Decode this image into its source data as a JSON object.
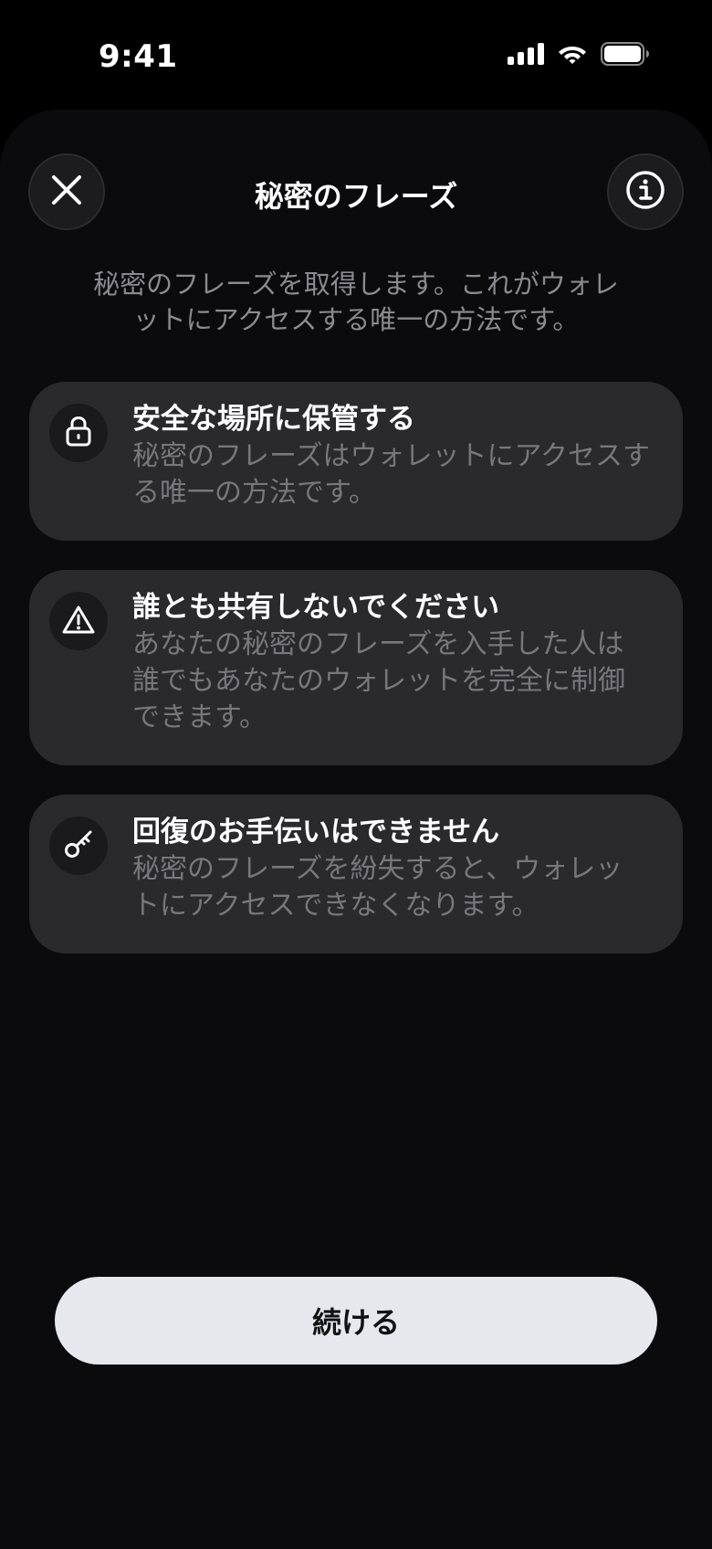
{
  "status_bar": {
    "time": "9:41"
  },
  "header": {
    "title": "秘密のフレーズ",
    "close_icon": "close-icon",
    "info_icon": "info-icon"
  },
  "subtitle": "秘密のフレーズを取得します。これがウォレットにアクセスする唯一の方法です。",
  "cards": [
    {
      "icon": "lock-icon",
      "title": "安全な場所に保管する",
      "description": "秘密のフレーズはウォレットにアクセスする唯一の方法です。"
    },
    {
      "icon": "warning-icon",
      "title": "誰とも共有しないでください",
      "description": "あなたの秘密のフレーズを入手した人は誰でもあなたのウォレットを完全に制御できます。"
    },
    {
      "icon": "key-icon",
      "title": "回復のお手伝いはできません",
      "description": "秘密のフレーズを紛失すると、ウォレットにアクセスできなくなります。"
    }
  ],
  "continue_button": {
    "label": "続ける"
  },
  "colors": {
    "background": "#000000",
    "sheet": "#0b0b0d",
    "card": "#2a2a2d",
    "muted_text": "#8a8a90",
    "button": "#e6e8ee"
  }
}
